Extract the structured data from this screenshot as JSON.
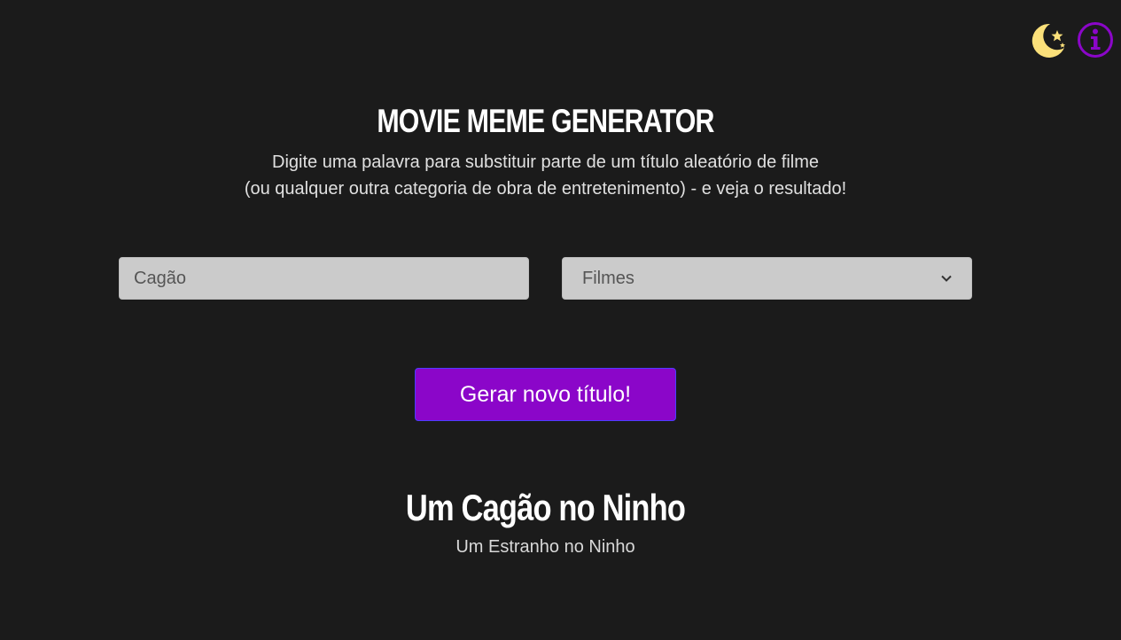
{
  "header": {
    "title": "MOVIE MEME GENERATOR",
    "subtitle_line1": "Digite uma palavra para substituir parte de um título aleatório de filme",
    "subtitle_line2": "(ou qualquer outra categoria de obra de entretenimento) - e veja o resultado!"
  },
  "icons": {
    "theme_toggle": "moon-stars-icon",
    "info": "info-icon"
  },
  "form": {
    "word_input": {
      "value": "",
      "placeholder": "Cagão"
    },
    "category_select": {
      "selected": "Filmes"
    },
    "generate_label": "Gerar novo título!"
  },
  "result": {
    "new_title": "Um Cagão no Ninho",
    "original_title": "Um Estranho no Ninho"
  },
  "colors": {
    "background": "#1b1b1b",
    "accent": "#8b06c9",
    "moon": "#fbe07a"
  }
}
